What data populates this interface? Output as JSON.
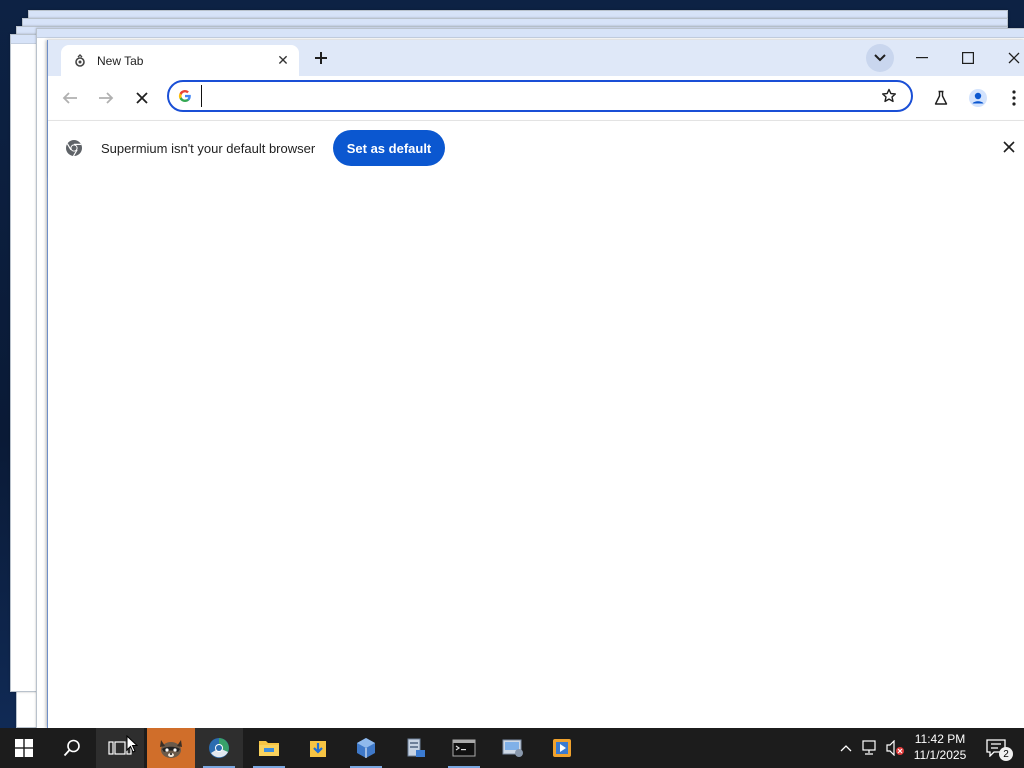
{
  "browser": {
    "tab": {
      "title": "New Tab",
      "close_label": "✕"
    },
    "new_tab_label": "+",
    "tab_search_label": "⌄",
    "window_controls": {
      "minimize": "—",
      "maximize": "☐",
      "close": "✕"
    },
    "toolbar": {
      "back": "←",
      "forward": "→",
      "stop": "✕",
      "omnibox": {
        "value": "",
        "placeholder": ""
      }
    },
    "infobar": {
      "message": "Supermium isn't your default browser",
      "button_label": "Set as default",
      "close_label": "✕"
    }
  },
  "taskbar": {
    "clock": {
      "time": "11:42 PM",
      "date": "11/1/2025"
    },
    "notification_count": "2",
    "pinned": [
      "start",
      "search",
      "task-view",
      "app-raccoon",
      "supermium",
      "file-explorer",
      "downloads",
      "virtualbox",
      "server-manager",
      "terminal",
      "network-settings",
      "media-player"
    ]
  },
  "colors": {
    "accent": "#0b57d0",
    "titlebar": "#dfe8f8",
    "taskbar": "#1c1c1c",
    "active_task": "#d06e2a"
  }
}
